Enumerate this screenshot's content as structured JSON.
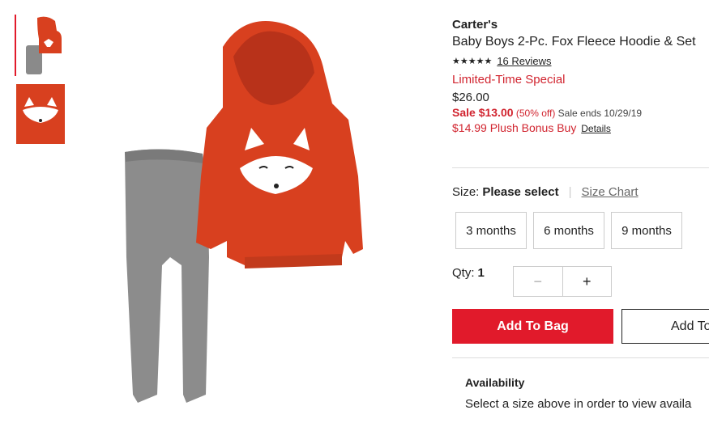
{
  "product": {
    "brand": "Carter's",
    "title": "Baby Boys 2-Pc. Fox Fleece Hoodie & Set",
    "stars": "★★★★★",
    "reviews": "16 Reviews",
    "special_label": "Limited-Time Special",
    "regular_price": "$26.00",
    "sale_price": "Sale $13.00",
    "discount": "(50% off)",
    "sale_ends": "Sale ends 10/29/19",
    "bonus": "$14.99 Plush Bonus Buy",
    "bonus_details": "Details"
  },
  "size": {
    "label": "Size:",
    "selected": "Please select",
    "separator": "|",
    "chart_link": "Size Chart",
    "options": [
      "3 months",
      "6 months",
      "9 months"
    ]
  },
  "quantity": {
    "label": "Qty:",
    "value": "1",
    "minus": "−",
    "plus": "+"
  },
  "actions": {
    "add_to_bag": "Add To Bag",
    "add_to_list": "Add To"
  },
  "availability": {
    "title": "Availability",
    "text": "Select a size above in order to view availa"
  },
  "colors": {
    "accent_red": "#e11a2b",
    "hoodie_orange": "#d8401f",
    "pants_gray": "#8a8a8a"
  }
}
